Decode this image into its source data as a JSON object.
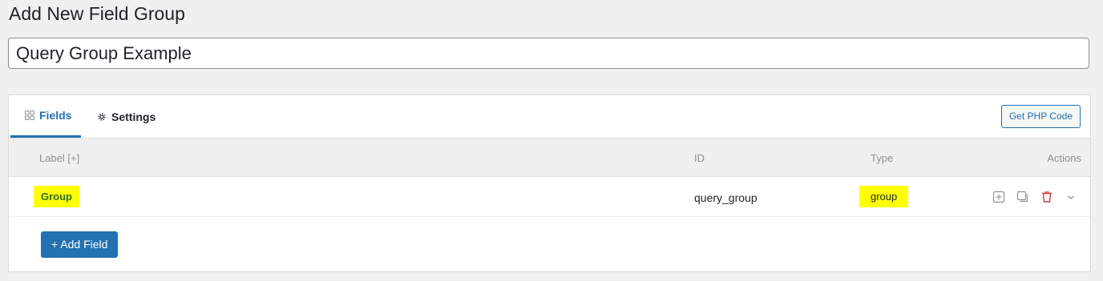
{
  "page": {
    "title": "Add New Field Group"
  },
  "title_input": {
    "value": "Query Group Example"
  },
  "tabs": [
    {
      "label": "Fields",
      "icon": "grid-icon",
      "active": true
    },
    {
      "label": "Settings",
      "icon": "gear-icon",
      "active": false
    }
  ],
  "toolbar": {
    "php_label": "Get PHP Code"
  },
  "table": {
    "columns": [
      "Label [+]",
      "ID",
      "Type",
      "Actions"
    ],
    "rows": [
      {
        "label": "Group",
        "id": "query_group",
        "type": "group",
        "highlight": "#ffff00"
      }
    ]
  },
  "add_field": {
    "label": "+ Add Field"
  },
  "colors": {
    "accent": "#2271b1",
    "delete": "#d63638",
    "highlight": "#ffff00",
    "background": "#f0f0f1"
  }
}
